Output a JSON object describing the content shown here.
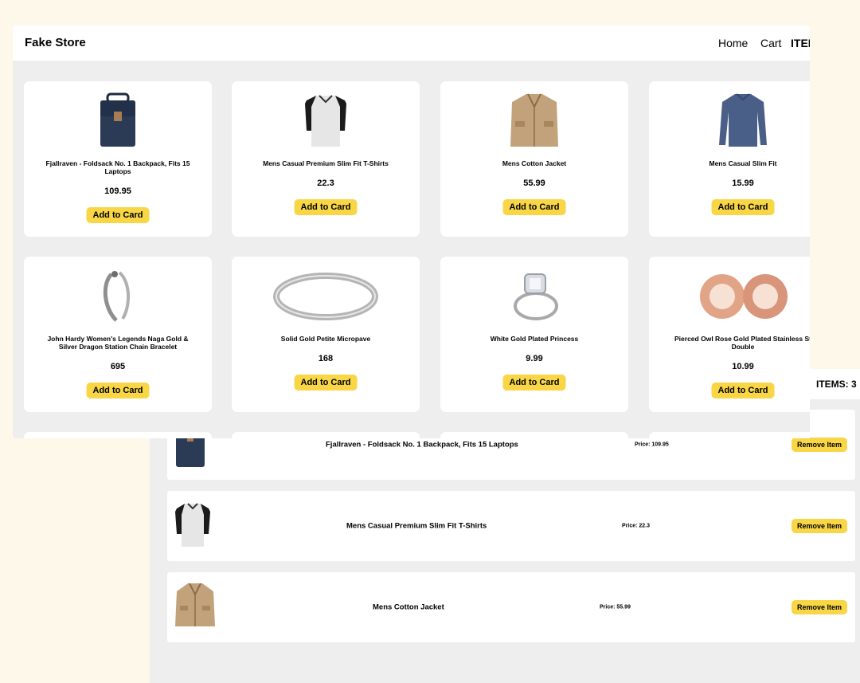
{
  "store": {
    "brand": "Fake Store",
    "nav": {
      "home": "Home",
      "cart": "Cart",
      "items_fragment": "ITEI"
    },
    "button_label": "Add to Card",
    "products": [
      {
        "title": "Fjallraven - Foldsack No. 1 Backpack, Fits 15 Laptops",
        "price": "109.95",
        "image": "backpack-icon"
      },
      {
        "title": "Mens Casual Premium Slim Fit T-Shirts",
        "price": "22.3",
        "image": "raglan-tshirt-icon"
      },
      {
        "title": "Mens Cotton Jacket",
        "price": "55.99",
        "image": "jacket-icon"
      },
      {
        "title": "Mens Casual Slim Fit",
        "price": "15.99",
        "image": "longsleeve-shirt-icon"
      },
      {
        "title": "John Hardy Women's Legends Naga Gold & Silver Dragon Station Chain Bracelet",
        "price": "695",
        "image": "bracelet-icon"
      },
      {
        "title": "Solid Gold Petite Micropave",
        "price": "168",
        "image": "ring-band-icon"
      },
      {
        "title": "White Gold Plated Princess",
        "price": "9.99",
        "image": "diamond-ring-icon"
      },
      {
        "title": "Pierced Owl Rose Gold Plated Stainless St Double",
        "price": "10.99",
        "image": "ear-tunnel-icon"
      }
    ]
  },
  "cart": {
    "items_count": "ITEMS: 3",
    "remove_label": "Remove Item",
    "items": [
      {
        "title": "Fjallraven - Foldsack No. 1 Backpack, Fits 15 Laptops",
        "price": "Price: 109.95",
        "image": "backpack-icon"
      },
      {
        "title": "Mens Casual Premium Slim Fit T-Shirts",
        "price": "Price: 22.3",
        "image": "raglan-tshirt-icon"
      },
      {
        "title": "Mens Cotton Jacket",
        "price": "Price: 55.99",
        "image": "jacket-icon"
      }
    ]
  },
  "colors": {
    "accent": "#f8d646",
    "page_bg": "#eeeeee",
    "desktop_bg": "#fdf8ea",
    "card_bg": "#ffffff"
  }
}
